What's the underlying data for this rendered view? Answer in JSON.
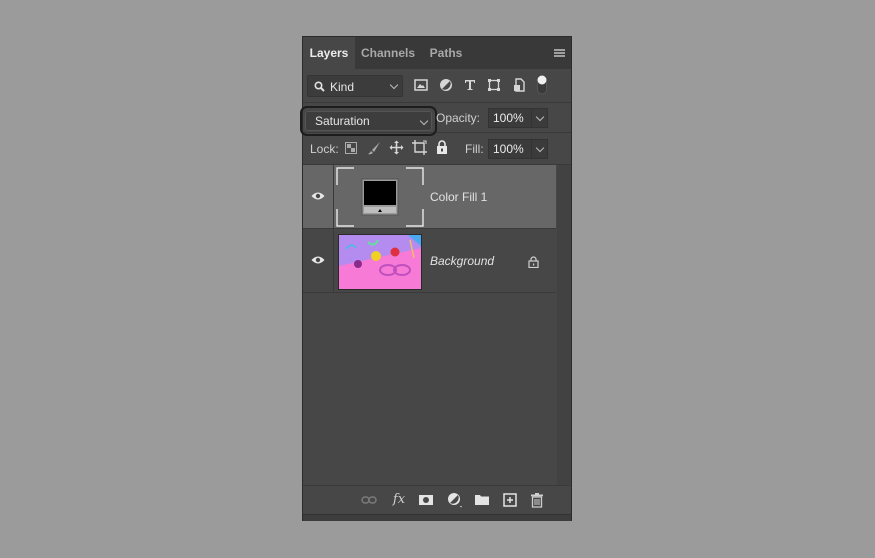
{
  "panel": {
    "tabs": [
      {
        "label": "Layers",
        "active": true
      },
      {
        "label": "Channels",
        "active": false
      },
      {
        "label": "Paths",
        "active": false
      }
    ],
    "menu_icon": "panel-menu-icon"
  },
  "filter": {
    "kind_label": "Kind",
    "icons": [
      "pixel-layer-filter-icon",
      "adjustment-layer-filter-icon",
      "type-layer-filter-icon",
      "shape-layer-filter-icon",
      "smart-object-filter-icon",
      "filter-toggle-icon"
    ]
  },
  "blend": {
    "mode": "Saturation",
    "opacity_label": "Opacity:",
    "opacity_value": "100%"
  },
  "lock": {
    "label": "Lock:",
    "icons": [
      "lock-transparent-pixels-icon",
      "lock-image-pixels-icon",
      "lock-position-icon",
      "lock-artboard-icon",
      "lock-all-icon"
    ],
    "fill_label": "Fill:",
    "fill_value": "100%"
  },
  "layers": [
    {
      "name": "Color Fill 1",
      "type": "fill",
      "selected": true,
      "visible": true,
      "locked": false
    },
    {
      "name": "Background",
      "type": "image",
      "selected": false,
      "visible": true,
      "locked": true
    }
  ],
  "bottom_toolbar": {
    "icons": [
      "link-layers-icon",
      "fx-icon",
      "add-mask-icon",
      "new-adjustment-layer-icon",
      "new-group-icon",
      "new-layer-icon",
      "delete-layer-icon"
    ],
    "fx_label": "fx"
  },
  "colors": {
    "panel_bg": "#474747",
    "selected_layer": "#676767",
    "canvas_bg": "#9b9b9b"
  }
}
